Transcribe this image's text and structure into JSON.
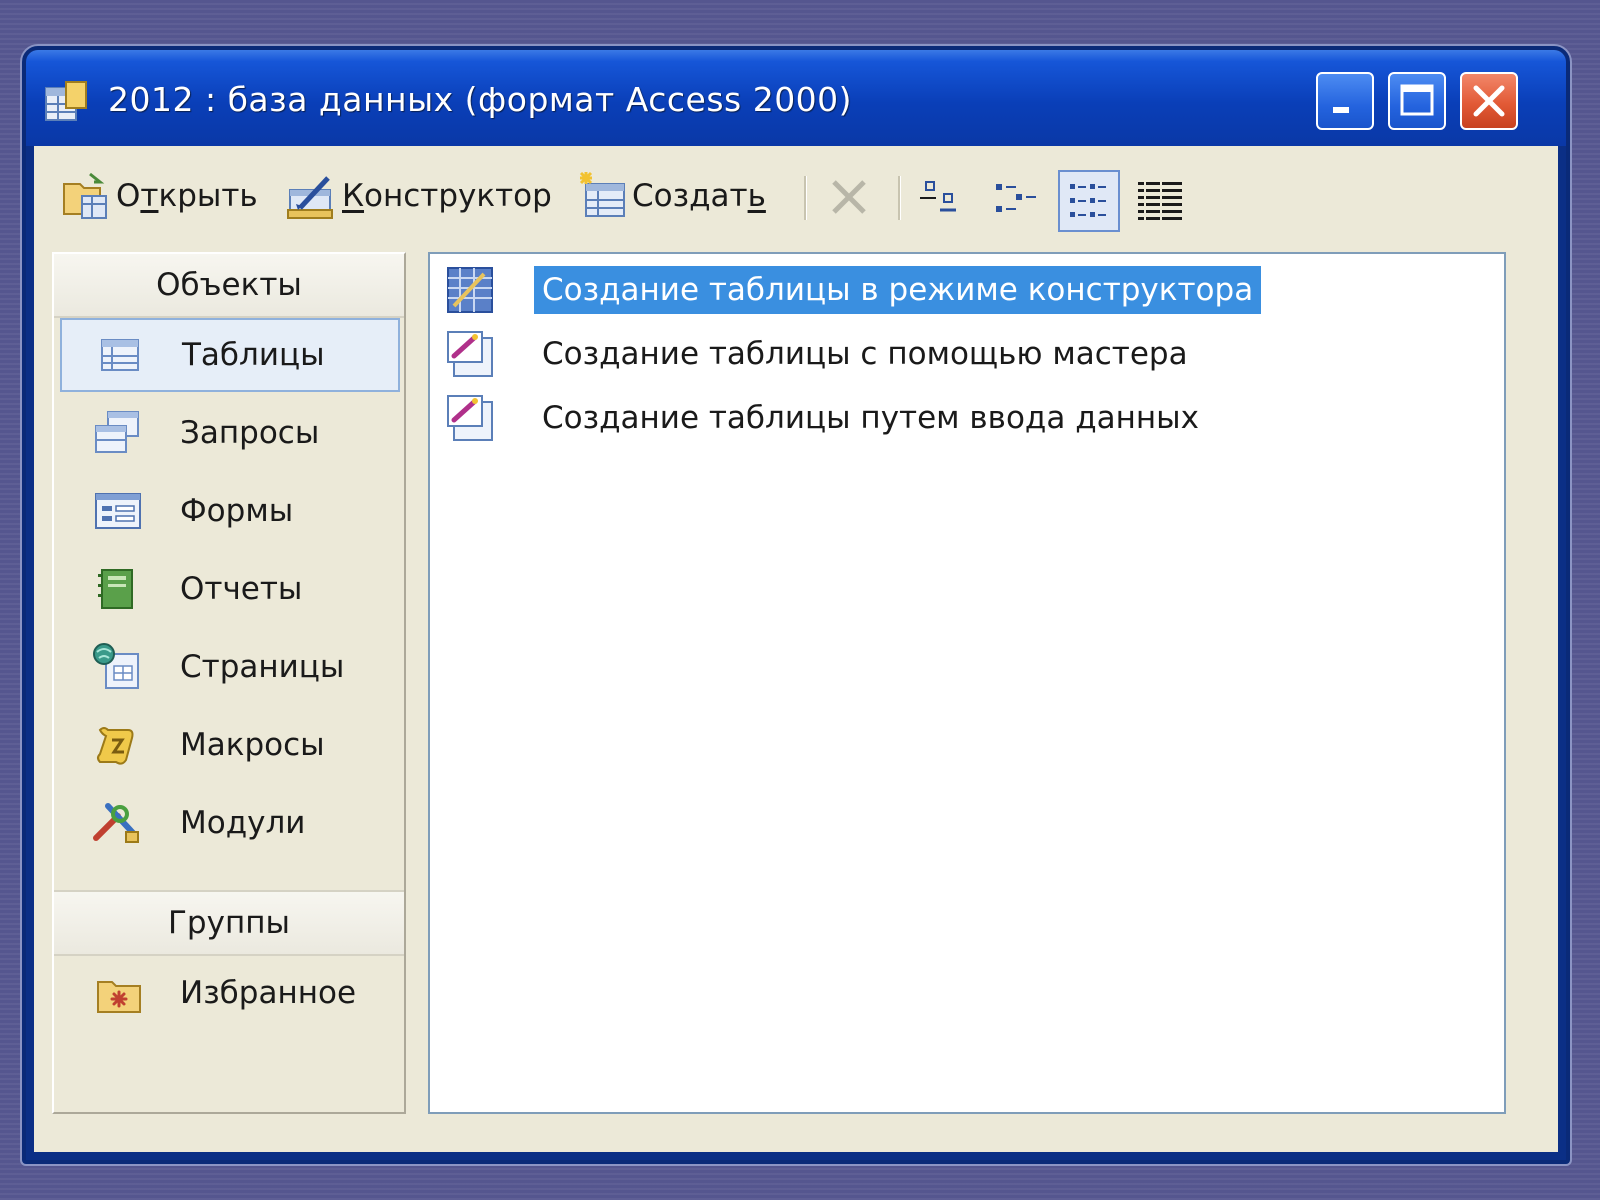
{
  "window": {
    "title": "2012 : база данных (формат Access 2000)",
    "controls": {
      "minimize": "minimize-icon",
      "maximize": "maximize-icon",
      "close": "close-icon"
    }
  },
  "toolbar": {
    "open_label_prefix": "О",
    "open_label_accel": "т",
    "open_label_suffix": "крыть",
    "design_label_accel": "К",
    "design_label_suffix": "онструктор",
    "create_label_prefix": "Создат",
    "create_label_accel": "ь",
    "view_modes": [
      "large-icons",
      "small-icons",
      "list",
      "details"
    ],
    "active_view": "list"
  },
  "objects_pane": {
    "header": "Объекты",
    "items": [
      {
        "label": "Таблицы",
        "icon": "table-icon",
        "selected": true
      },
      {
        "label": "Запросы",
        "icon": "query-icon"
      },
      {
        "label": "Формы",
        "icon": "form-icon"
      },
      {
        "label": "Отчеты",
        "icon": "report-icon"
      },
      {
        "label": "Страницы",
        "icon": "page-icon"
      },
      {
        "label": "Макросы",
        "icon": "macro-icon"
      },
      {
        "label": "Модули",
        "icon": "module-icon"
      }
    ],
    "groups_header": "Группы",
    "groups": [
      {
        "label": "Избранное",
        "icon": "favorites-folder-icon"
      }
    ]
  },
  "content": {
    "items": [
      {
        "label": "Создание таблицы в режиме конструктора",
        "icon": "design-table-icon",
        "selected": true
      },
      {
        "label": "Создание таблицы с помощью мастера",
        "icon": "wizard-icon"
      },
      {
        "label": "Создание таблицы путем ввода данных",
        "icon": "wizard-icon"
      }
    ]
  },
  "colors": {
    "titlebar": "#0a3fb8",
    "selection": "#3a8fe0",
    "close_button": "#e25a36"
  }
}
